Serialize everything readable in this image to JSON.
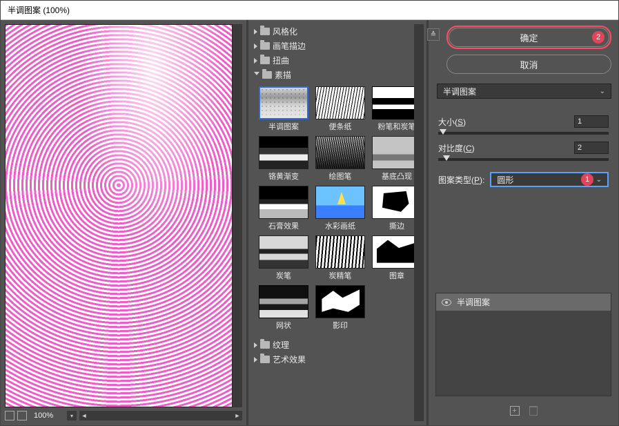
{
  "window": {
    "title": "半调图案 (100%)"
  },
  "preview": {
    "zoom": "100%"
  },
  "categories": [
    {
      "label": "风格化",
      "open": false
    },
    {
      "label": "画笔描边",
      "open": false
    },
    {
      "label": "扭曲",
      "open": false
    },
    {
      "label": "素描",
      "open": true
    },
    {
      "label": "纹理",
      "open": false
    },
    {
      "label": "艺术效果",
      "open": false
    }
  ],
  "sketch_filters": [
    {
      "label": "半调图案",
      "cls": "t-halftone",
      "selected": true
    },
    {
      "label": "便条纸",
      "cls": "t-notepaper"
    },
    {
      "label": "粉笔和炭笔",
      "cls": "t-chalk"
    },
    {
      "label": "铬黄渐变",
      "cls": "t-chrome"
    },
    {
      "label": "绘图笔",
      "cls": "t-graphic"
    },
    {
      "label": "基底凸现",
      "cls": "t-bas"
    },
    {
      "label": "石膏效果",
      "cls": "t-plaster"
    },
    {
      "label": "水彩画纸",
      "cls": "t-water"
    },
    {
      "label": "撕边",
      "cls": "t-torn"
    },
    {
      "label": "炭笔",
      "cls": "t-charcoal"
    },
    {
      "label": "炭精笔",
      "cls": "t-conte"
    },
    {
      "label": "图章",
      "cls": "t-stamp"
    },
    {
      "label": "网状",
      "cls": "t-retic"
    },
    {
      "label": "影印",
      "cls": "t-photocopy"
    }
  ],
  "buttons": {
    "ok": "确定",
    "cancel": "取消",
    "ok_badge": "2"
  },
  "filter_select": {
    "value": "半调图案"
  },
  "params": {
    "size_label_pre": "大小(",
    "size_key": "S",
    "size_label_post": ")",
    "size_value": "1",
    "contrast_label_pre": "对比度(",
    "contrast_key": "C",
    "contrast_label_post": ")",
    "contrast_value": "2",
    "pattern_label_pre": "图案类型(",
    "pattern_key": "P",
    "pattern_label_post": "):",
    "pattern_value": "圆形",
    "pattern_badge": "1"
  },
  "layers": {
    "active": "半调图案"
  }
}
